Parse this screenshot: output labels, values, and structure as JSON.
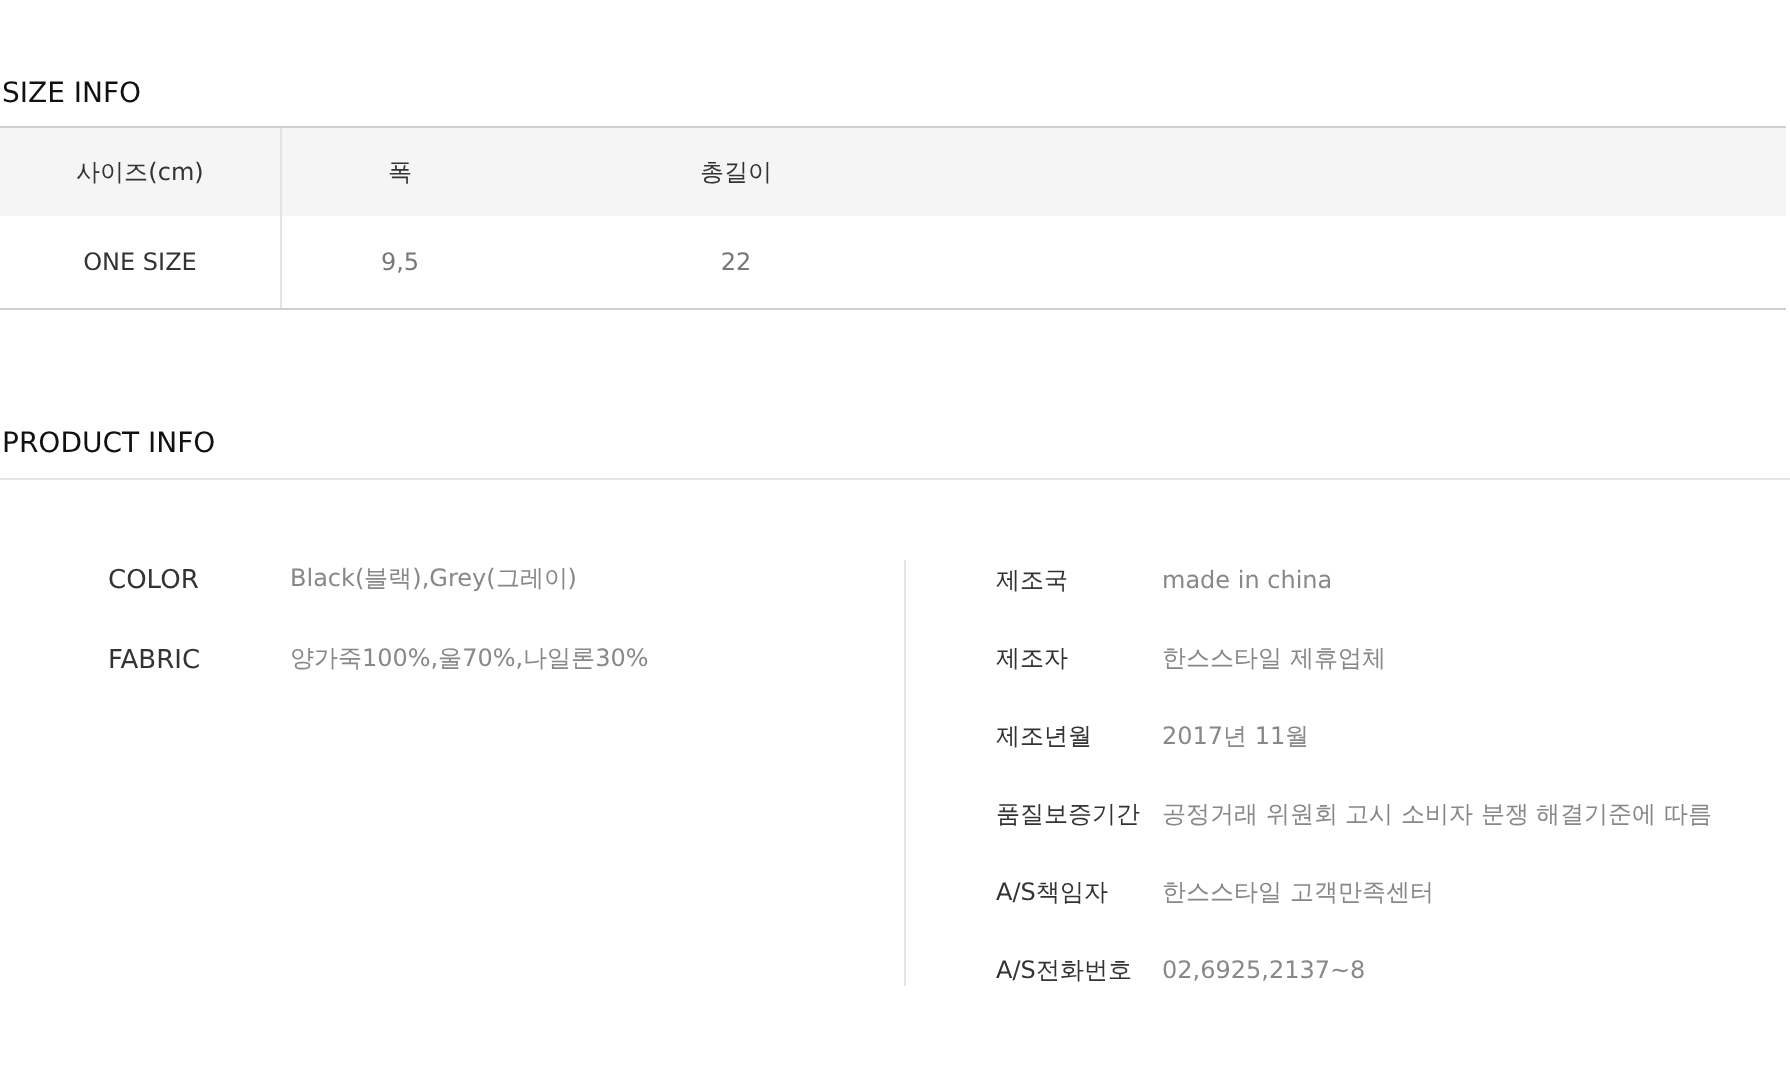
{
  "size_info": {
    "title": "SIZE INFO",
    "columns": [
      "사이즈(cm)",
      "폭",
      "총길이"
    ],
    "rows": [
      [
        "ONE SIZE",
        "9,5",
        "22"
      ]
    ]
  },
  "product_info": {
    "title": "PRODUCT INFO",
    "left": [
      {
        "label": "COLOR",
        "value": "Black(블랙),Grey(그레이)"
      },
      {
        "label": "FABRIC",
        "value": "양가죽100%,울70%,나일론30%"
      }
    ],
    "right": [
      {
        "label": "제조국",
        "value": "made in china"
      },
      {
        "label": "제조자",
        "value": "한스스타일 제휴업체"
      },
      {
        "label": "제조년월",
        "value": "2017년 11월"
      },
      {
        "label": "품질보증기간",
        "value": "공정거래 위원회 고시 소비자 분쟁 해결기준에 따름"
      },
      {
        "label": "A/S책임자",
        "value": "한스스타일 고객만족센터"
      },
      {
        "label": "A/S전화번호",
        "value": "02,6925,2137~8"
      }
    ]
  }
}
